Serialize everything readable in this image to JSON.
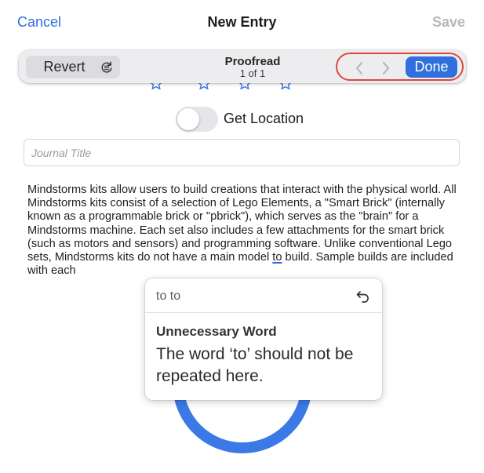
{
  "nav": {
    "cancel": "Cancel",
    "title": "New Entry",
    "save": "Save"
  },
  "rating": {
    "stars_visible": 4,
    "star_color": "#3b7ae6",
    "icon": "star-outline-icon"
  },
  "toolbar": {
    "revert": "Revert",
    "cycle_icon": "cycle-icon",
    "proofread_title": "Proofread",
    "proofread_count": "1 of 1",
    "prev_icon": "chevron-left-icon",
    "next_icon": "chevron-right-icon",
    "done": "Done",
    "highlight_color": "#e0463b"
  },
  "location": {
    "label": "Get Location",
    "enabled": false
  },
  "journal_title": {
    "placeholder": "Journal Title",
    "value": ""
  },
  "body": {
    "before": "Mindstorms kits allow users to build creations that interact with the physical world. All Mindstorms kits consist of a selection of Lego Elements, a \"Smart Brick\" (internally known as a programmable brick or \"pbrick\"), which serves as the \"brain\" for a Mindstorms machine. Each set also includes a few attachments for the smart brick (such as motors and sensors) and programming software. Unlike conventional Lego sets, Mindstorms kits do not have a main model ",
    "flagged": "to",
    "after": " build. Sample builds are included with each"
  },
  "suggestion": {
    "original": "to to",
    "undo_icon": "undo-arrow-icon",
    "heading": "Unnecessary Word",
    "description": "The word ‘to’ should not be repeated here."
  },
  "colors": {
    "accent": "#2f6fde",
    "disabled": "#b9b9bd",
    "ring": "#3b7ae6"
  }
}
